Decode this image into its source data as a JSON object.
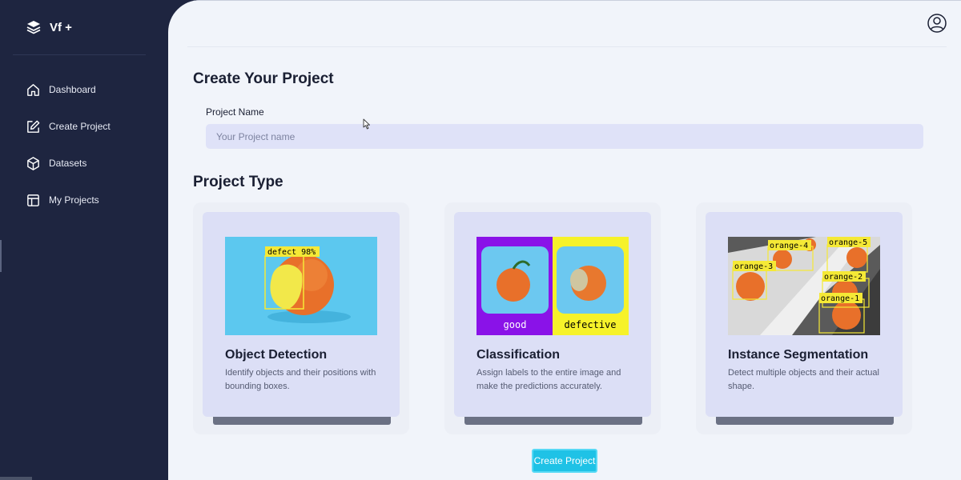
{
  "sidebar": {
    "brand": "Vf +",
    "items": [
      {
        "label": "Dashboard",
        "icon": "home-icon"
      },
      {
        "label": "Create Project",
        "icon": "edit-icon"
      },
      {
        "label": "Datasets",
        "icon": "box-icon"
      },
      {
        "label": "My Projects",
        "icon": "layout-icon"
      }
    ]
  },
  "header": {
    "avatar_icon": "user-circle-icon"
  },
  "form": {
    "title": "Create Your Project",
    "project_name_label": "Project Name",
    "project_name_placeholder": "Your Project name",
    "project_name_value": ""
  },
  "project_type": {
    "title": "Project Type",
    "cards": [
      {
        "title": "Object Detection",
        "description": "Identify objects and their positions with bounding boxes.",
        "image_labels": [
          "defect 98%"
        ]
      },
      {
        "title": "Classification",
        "description": "Assign labels to the entire image and make the predictions accurately.",
        "image_labels": [
          "good",
          "defective"
        ]
      },
      {
        "title": "Instance Segmentation",
        "description": "Detect multiple objects and their actual shape.",
        "image_labels": [
          "orange-4",
          "orange-5",
          "orange-3",
          "orange-2",
          "orange-1"
        ]
      }
    ]
  },
  "actions": {
    "create_label": "Create Project"
  },
  "colors": {
    "sidebar_bg": "#1e2540",
    "main_bg": "#f1f4fa",
    "card_bg": "#dcdff6",
    "input_bg": "#dfe2f8",
    "button_bg": "#1fc2e6"
  }
}
